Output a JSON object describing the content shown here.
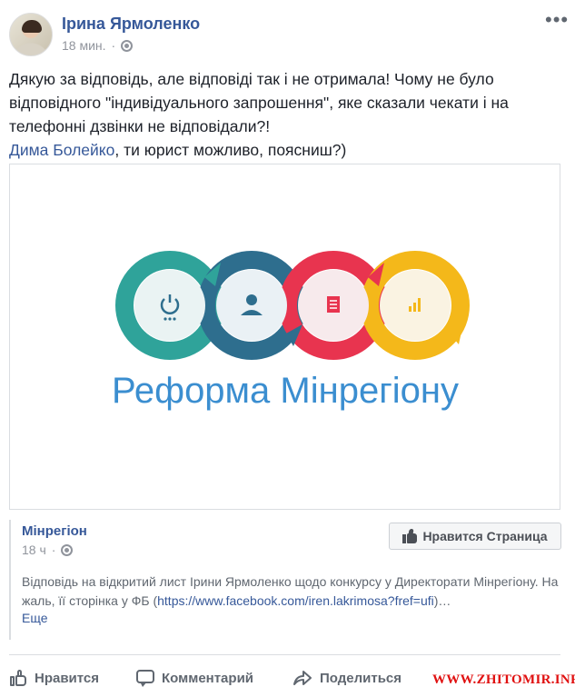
{
  "post": {
    "author": "Ірина Ярмоленко",
    "time": "18 мин.",
    "separator": "·",
    "more_icon": "more-horizontal-icon",
    "text_line1": "Дякую за відповідь, але відповіді так і не отримала! Чому не було відповідного \"індивідуального запрошення\", яке сказали чекати і на телефонні дзвінки не відповідали?!",
    "mention": "Дима Болейко",
    "text_after_mention": ", ти юрист можливо, поясниш?)"
  },
  "card": {
    "image_title": "Реформа Мінрегіону",
    "circle_colors": [
      "#2fa39a",
      "#2e6e8e",
      "#e8344f",
      "#f4b81a"
    ],
    "title_color": "#3b8ed0"
  },
  "shared": {
    "page_name": "Мінрегіон",
    "time": "18 ч",
    "separator": "·",
    "like_page_label": "Нравится Страница",
    "description_text": "Відповідь на відкритий лист Ірини Ярмоленко щодо конкурсу у Директорати Мінрегіону. На жаль, її сторінка у ФБ (",
    "description_link": "https://www.facebook.com/iren.lakrimosa?fref=ufi",
    "description_end": ")…",
    "see_more": "Еще"
  },
  "actions": {
    "like": "Нравится",
    "comment": "Комментарий",
    "share": "Поделиться"
  },
  "watermark": "WWW.ZHITOMIR.INFO",
  "colors": {
    "link": "#365899",
    "muted": "#90949c",
    "watermark": "#e01010"
  }
}
